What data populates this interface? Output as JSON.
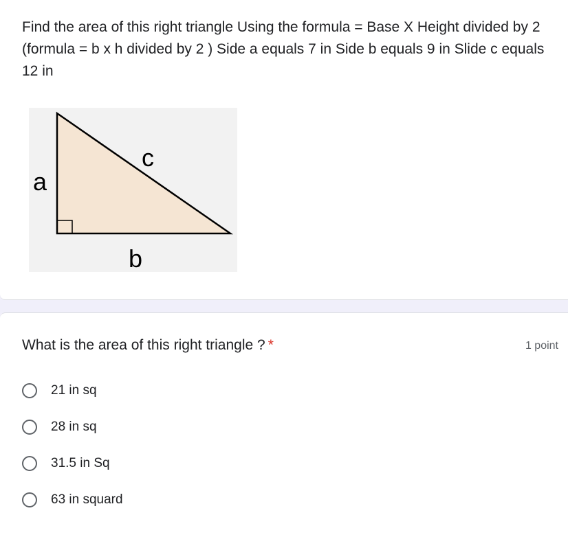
{
  "description": "Find the area of this right triangle Using the formula = Base X Height divided by 2 (formula = b x h divided by 2 ) Side a equals 7 in Side b equals 9 in Slide c equals 12 in",
  "figure": {
    "label_a": "a",
    "label_b": "b",
    "label_c": "c",
    "fill_color": "#f5e5d3"
  },
  "question": {
    "title": "What is the area of this right triangle ?",
    "required_mark": "*",
    "points": "1 point",
    "options": [
      {
        "label": "21 in sq",
        "selected": false
      },
      {
        "label": "28 in sq",
        "selected": false
      },
      {
        "label": "31.5 in Sq",
        "selected": false
      },
      {
        "label": "63 in squard",
        "selected": false
      }
    ]
  }
}
